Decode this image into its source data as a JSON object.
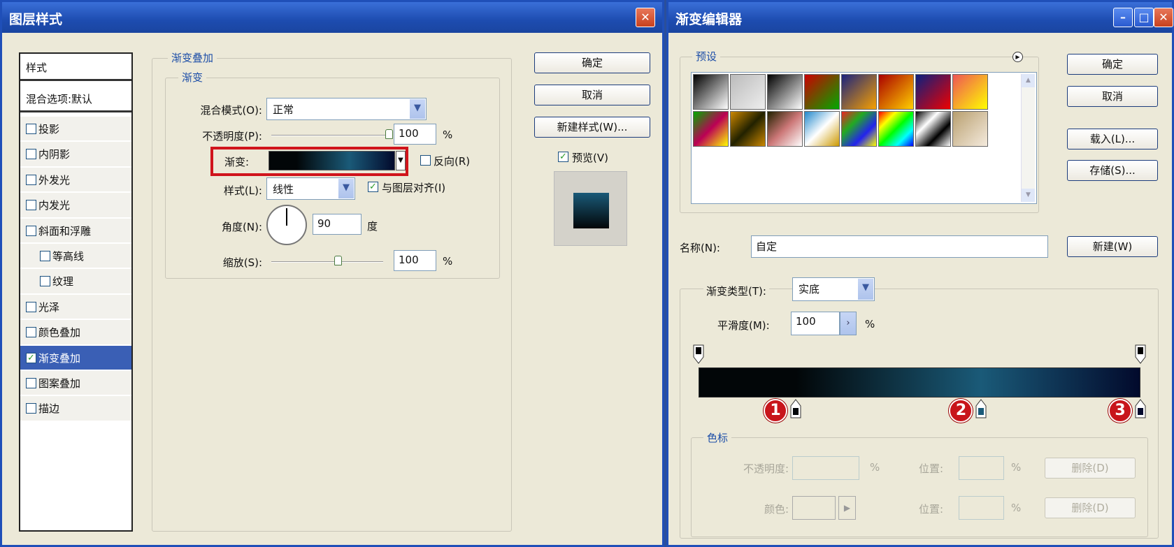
{
  "left_dialog": {
    "title": "图层样式",
    "styles_list": [
      {
        "label": "样式",
        "type": "header"
      },
      {
        "label": "混合选项:默认",
        "type": "header"
      },
      {
        "label": "投影",
        "checked": false,
        "indent": false
      },
      {
        "label": "内阴影",
        "checked": false,
        "indent": false
      },
      {
        "label": "外发光",
        "checked": false,
        "indent": false
      },
      {
        "label": "内发光",
        "checked": false,
        "indent": false
      },
      {
        "label": "斜面和浮雕",
        "checked": false,
        "indent": false
      },
      {
        "label": "等高线",
        "checked": false,
        "indent": true
      },
      {
        "label": "纹理",
        "checked": false,
        "indent": true
      },
      {
        "label": "光泽",
        "checked": false,
        "indent": false
      },
      {
        "label": "颜色叠加",
        "checked": false,
        "indent": false
      },
      {
        "label": "渐变叠加",
        "checked": true,
        "indent": false,
        "selected": true
      },
      {
        "label": "图案叠加",
        "checked": false,
        "indent": false
      },
      {
        "label": "描边",
        "checked": false,
        "indent": false
      }
    ],
    "group_title": "渐变叠加",
    "subgroup_title": "渐变",
    "blend_mode_label": "混合模式(O):",
    "blend_mode_value": "正常",
    "opacity_label": "不透明度(P):",
    "opacity_value": "100",
    "opacity_unit": "%",
    "opacity_fraction": 0.98,
    "gradient_label": "渐变:",
    "reverse_label": "反向(R)",
    "reverse_checked": false,
    "style_label": "样式(L):",
    "style_value": "线性",
    "align_label": "与图层对齐(I)",
    "align_checked": true,
    "angle_label": "角度(N):",
    "angle_value": "90",
    "angle_unit": "度",
    "scale_label": "缩放(S):",
    "scale_value": "100",
    "scale_unit": "%",
    "scale_fraction": 0.6,
    "ok": "确定",
    "cancel": "取消",
    "new_style": "新建样式(W)...",
    "preview_label": "预览(V)",
    "preview_checked": true
  },
  "right_dialog": {
    "title": "渐变编辑器",
    "presets_label": "预设",
    "presets": [
      [
        "#000",
        "#fff"
      ],
      [
        "#bbb",
        "#eee"
      ],
      [
        "#000",
        "#fff"
      ],
      [
        "#c00",
        "#0a0"
      ],
      [
        "#1a237e",
        "#f7a000"
      ],
      [
        "#a00",
        "#ffd000"
      ],
      [
        "#0a2080",
        "#e00"
      ],
      [
        "#e55",
        "#ff0"
      ],
      [
        "#0a0",
        "#b05",
        "#ff0"
      ],
      [
        "#c80",
        "#220",
        "#c80"
      ],
      [
        "#220",
        "#c77",
        "#fff"
      ],
      [
        "#28c",
        "#fff",
        "#c90"
      ],
      [
        "#e22",
        "#2a2",
        "#22e",
        "#ff0"
      ],
      [
        "#f00",
        "#ff0",
        "#0f0",
        "#0ff",
        "#00f"
      ],
      [
        "#000",
        "#fff",
        "#000",
        "#fff"
      ],
      [
        "#b9a070",
        "#f4eadd"
      ]
    ],
    "ok": "确定",
    "cancel": "取消",
    "load": "载入(L)...",
    "save": "存储(S)...",
    "name_label": "名称(N):",
    "name_value": "自定",
    "new": "新建(W)",
    "type_label": "渐变类型(T):",
    "type_value": "实底",
    "smooth_label": "平滑度(M):",
    "smooth_value": "100",
    "smooth_unit": "%",
    "color_stops": [
      {
        "location": 22,
        "color": "#020608",
        "marker": "1"
      },
      {
        "location": 64,
        "color": "#1a5a78",
        "marker": "2"
      },
      {
        "location": 100,
        "color": "#020a2c",
        "marker": "3"
      }
    ],
    "opacity_stops": [
      {
        "location": 0,
        "color": "#000"
      },
      {
        "location": 100,
        "color": "#000"
      }
    ],
    "stops_group": "色标",
    "stop_opacity_label": "不透明度:",
    "stop_pct": "%",
    "stop_color_label": "颜色:",
    "location_label": "位置:",
    "delete": "删除(D)"
  },
  "colors": {
    "highlight": "#d0141c",
    "selection": "#3a5fb5"
  }
}
